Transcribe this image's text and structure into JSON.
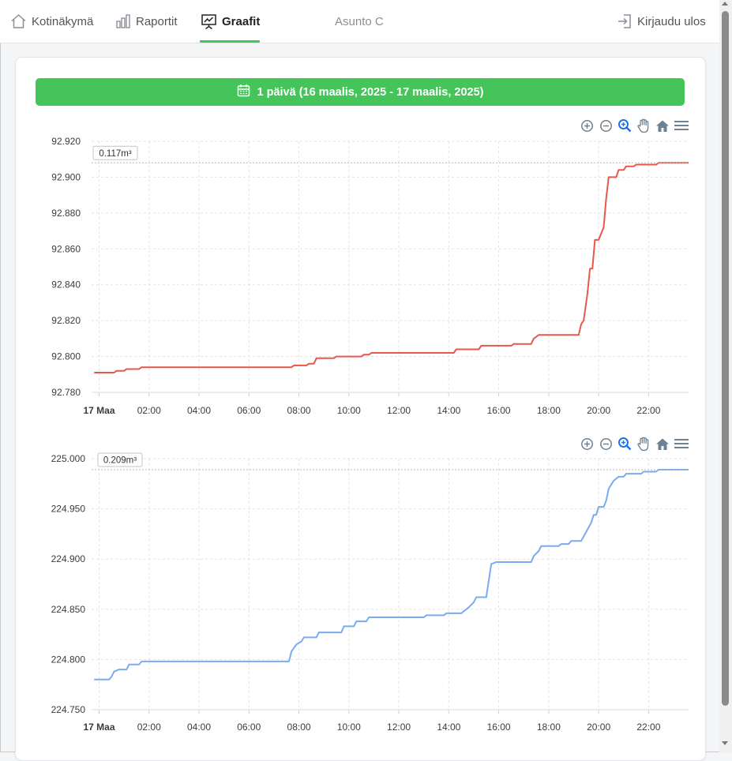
{
  "nav": {
    "home": "Kotinäkymä",
    "reports": "Raportit",
    "graphs": "Graafit",
    "apartment": "Asunto C",
    "logout": "Kirjaudu ulos"
  },
  "range": {
    "label": "1 päivä (16 maalis, 2025 - 17 maalis, 2025)"
  },
  "toolbar_icons": [
    "zoom-in-icon",
    "zoom-out-icon",
    "selection-zoom-icon",
    "pan-hand-icon",
    "home-reset-icon",
    "menu-icon"
  ],
  "colors": {
    "accent": "#45c45a",
    "series1": "#e8574a",
    "series2": "#7aaaf0",
    "toolbar": "#6e8192",
    "toolbar_active": "#1a73e8"
  },
  "chart_data": [
    {
      "type": "line",
      "annotation": "0.117m³",
      "ylim": [
        92.78,
        92.92
      ],
      "yticks": [
        "92.780",
        "92.800",
        "92.820",
        "92.840",
        "92.860",
        "92.880",
        "92.900",
        "92.920"
      ],
      "xlim": [
        -0.3,
        23.6
      ],
      "xticks": [
        {
          "v": 0,
          "label": "17 Maa",
          "bold": true
        },
        {
          "v": 2,
          "label": "02:00"
        },
        {
          "v": 4,
          "label": "04:00"
        },
        {
          "v": 6,
          "label": "06:00"
        },
        {
          "v": 8,
          "label": "08:00"
        },
        {
          "v": 10,
          "label": "10:00"
        },
        {
          "v": 12,
          "label": "12:00"
        },
        {
          "v": 14,
          "label": "14:00"
        },
        {
          "v": 16,
          "label": "16:00"
        },
        {
          "v": 18,
          "label": "18:00"
        },
        {
          "v": 20,
          "label": "20:00"
        },
        {
          "v": 22,
          "label": "22:00"
        }
      ],
      "series": [
        {
          "color": "#e8574a",
          "points": [
            [
              -0.2,
              92.791
            ],
            [
              0.6,
              92.791
            ],
            [
              0.7,
              92.792
            ],
            [
              1.0,
              92.792
            ],
            [
              1.1,
              92.793
            ],
            [
              1.6,
              92.793
            ],
            [
              1.7,
              92.794
            ],
            [
              7.7,
              92.794
            ],
            [
              7.8,
              92.795
            ],
            [
              8.3,
              92.795
            ],
            [
              8.4,
              92.796
            ],
            [
              8.6,
              92.796
            ],
            [
              8.7,
              92.799
            ],
            [
              9.4,
              92.799
            ],
            [
              9.5,
              92.8
            ],
            [
              10.5,
              92.8
            ],
            [
              10.6,
              92.801
            ],
            [
              10.8,
              92.801
            ],
            [
              10.9,
              92.802
            ],
            [
              14.2,
              92.802
            ],
            [
              14.3,
              92.804
            ],
            [
              15.2,
              92.804
            ],
            [
              15.3,
              92.806
            ],
            [
              16.5,
              92.806
            ],
            [
              16.6,
              92.807
            ],
            [
              17.3,
              92.807
            ],
            [
              17.4,
              92.81
            ],
            [
              17.6,
              92.812
            ],
            [
              19.2,
              92.812
            ],
            [
              19.3,
              92.818
            ],
            [
              19.4,
              92.82
            ],
            [
              19.55,
              92.835
            ],
            [
              19.65,
              92.849
            ],
            [
              19.75,
              92.849
            ],
            [
              19.85,
              92.865
            ],
            [
              20.0,
              92.865
            ],
            [
              20.2,
              92.872
            ],
            [
              20.3,
              92.888
            ],
            [
              20.4,
              92.9
            ],
            [
              20.7,
              92.9
            ],
            [
              20.8,
              92.904
            ],
            [
              21.0,
              92.904
            ],
            [
              21.1,
              92.906
            ],
            [
              21.4,
              92.906
            ],
            [
              21.5,
              92.907
            ],
            [
              22.3,
              92.907
            ],
            [
              22.4,
              92.908
            ],
            [
              23.6,
              92.908
            ]
          ]
        }
      ]
    },
    {
      "type": "line",
      "annotation": "0.209m³",
      "ylim": [
        224.75,
        225.0
      ],
      "yticks": [
        "224.750",
        "224.800",
        "224.850",
        "224.900",
        "224.950",
        "225.000"
      ],
      "xlim": [
        -0.3,
        23.6
      ],
      "xticks": [
        {
          "v": 0,
          "label": "17 Maa",
          "bold": true
        },
        {
          "v": 2,
          "label": "02:00"
        },
        {
          "v": 4,
          "label": "04:00"
        },
        {
          "v": 6,
          "label": "06:00"
        },
        {
          "v": 8,
          "label": "08:00"
        },
        {
          "v": 10,
          "label": "10:00"
        },
        {
          "v": 12,
          "label": "12:00"
        },
        {
          "v": 14,
          "label": "14:00"
        },
        {
          "v": 16,
          "label": "16:00"
        },
        {
          "v": 18,
          "label": "18:00"
        },
        {
          "v": 20,
          "label": "20:00"
        },
        {
          "v": 22,
          "label": "22:00"
        }
      ],
      "series": [
        {
          "color": "#7aaaf0",
          "points": [
            [
              -0.2,
              224.78
            ],
            [
              0.4,
              224.78
            ],
            [
              0.5,
              224.783
            ],
            [
              0.6,
              224.788
            ],
            [
              0.8,
              224.79
            ],
            [
              1.1,
              224.79
            ],
            [
              1.2,
              224.795
            ],
            [
              1.6,
              224.795
            ],
            [
              1.7,
              224.798
            ],
            [
              7.6,
              224.798
            ],
            [
              7.7,
              224.808
            ],
            [
              7.9,
              224.815
            ],
            [
              8.1,
              224.818
            ],
            [
              8.2,
              224.822
            ],
            [
              8.7,
              224.822
            ],
            [
              8.8,
              224.827
            ],
            [
              9.7,
              224.827
            ],
            [
              9.8,
              224.833
            ],
            [
              10.2,
              224.833
            ],
            [
              10.3,
              224.838
            ],
            [
              10.7,
              224.838
            ],
            [
              10.8,
              224.842
            ],
            [
              13.0,
              224.842
            ],
            [
              13.1,
              224.844
            ],
            [
              13.8,
              224.844
            ],
            [
              13.9,
              224.846
            ],
            [
              14.5,
              224.846
            ],
            [
              14.6,
              224.848
            ],
            [
              14.8,
              224.852
            ],
            [
              15.0,
              224.857
            ],
            [
              15.1,
              224.862
            ],
            [
              15.5,
              224.862
            ],
            [
              15.6,
              224.878
            ],
            [
              15.7,
              224.895
            ],
            [
              15.9,
              224.897
            ],
            [
              17.3,
              224.897
            ],
            [
              17.4,
              224.903
            ],
            [
              17.6,
              224.908
            ],
            [
              17.7,
              224.913
            ],
            [
              18.4,
              224.913
            ],
            [
              18.5,
              224.915
            ],
            [
              18.8,
              224.915
            ],
            [
              18.9,
              224.918
            ],
            [
              19.3,
              224.918
            ],
            [
              19.5,
              224.927
            ],
            [
              19.7,
              224.936
            ],
            [
              19.8,
              224.944
            ],
            [
              19.9,
              224.944
            ],
            [
              20.0,
              224.952
            ],
            [
              20.2,
              224.952
            ],
            [
              20.3,
              224.958
            ],
            [
              20.4,
              224.97
            ],
            [
              20.6,
              224.978
            ],
            [
              20.8,
              224.982
            ],
            [
              21.0,
              224.982
            ],
            [
              21.1,
              224.985
            ],
            [
              21.7,
              224.985
            ],
            [
              21.8,
              224.987
            ],
            [
              22.3,
              224.987
            ],
            [
              22.4,
              224.989
            ],
            [
              23.6,
              224.989
            ]
          ]
        }
      ]
    }
  ]
}
